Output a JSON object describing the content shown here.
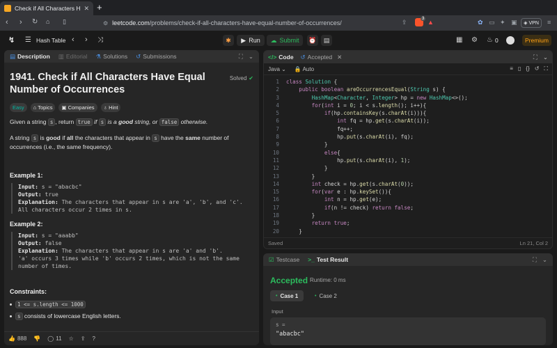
{
  "browser": {
    "tab_title": "Check if All Characters Have",
    "url_host": "leetcode.com",
    "url_path": "/problems/check-if-all-characters-have-equal-number-of-occurrences/",
    "shield_count": "3",
    "vpn_label": "VPN"
  },
  "header": {
    "problem_list": "Hash Table",
    "run_label": "Run",
    "submit_label": "Submit",
    "streak_count": "0",
    "premium_label": "Premium"
  },
  "left": {
    "tabs": {
      "description": "Description",
      "editorial": "Editorial",
      "solutions": "Solutions",
      "submissions": "Submissions"
    },
    "title": "1941. Check if All Characters Have Equal Number of Occurrences",
    "solved": "Solved",
    "chips": {
      "difficulty": "Easy",
      "topics": "Topics",
      "companies": "Companies",
      "hint": "Hint"
    },
    "p1": {
      "a": "Given a string ",
      "s": "s",
      "b": ", return ",
      "true": "true",
      "c": " if ",
      "s2": "s",
      "d": " is a ",
      "good": "good",
      "e": " string, or ",
      "false": "false",
      "f": " otherwise."
    },
    "p2": {
      "a": "A string ",
      "s": "s",
      "b": " is ",
      "good": "good",
      "c": " if ",
      "all": "all",
      "d": " the characters that appear in ",
      "s2": "s",
      "e": " have the ",
      "same": "same",
      "f": " number of occurrences (i.e., the same frequency)."
    },
    "example1": {
      "heading": "Example 1:",
      "input_label": "Input:",
      "input": " s = \"abacbc\"",
      "output_label": "Output:",
      "output": " true",
      "expl_label": "Explanation:",
      "expl": " The characters that appear in s are 'a', 'b', and 'c'. All characters occur 2 times in s."
    },
    "example2": {
      "heading": "Example 2:",
      "input_label": "Input:",
      "input": " s = \"aaabb\"",
      "output_label": "Output:",
      "output": " false",
      "expl_label": "Explanation:",
      "expl": " The characters that appear in s are 'a' and 'b'.",
      "expl2": "'a' occurs 3 times while 'b' occurs 2 times, which is not the same number of times."
    },
    "constraints": {
      "heading": "Constraints:",
      "c1": "1 <= s.length <= 1000",
      "c2_code": "s",
      "c2_text": " consists of lowercase English letters."
    },
    "footer": {
      "likes": "888",
      "comments": "11"
    }
  },
  "code": {
    "tab_code": "Code",
    "tab_accepted": "Accepted",
    "language": "Java",
    "mode": "Auto",
    "status": "Saved",
    "cursor": "Ln 21, Col 2",
    "lines": [
      "class Solution {",
      "    public boolean areOccurrencesEqual(String s) {",
      "        HashMap<Character, Integer> hp = new HashMap<>();",
      "        for(int i = 0; i < s.length(); i++){",
      "            if(hp.containsKey(s.charAt(i))){",
      "                int fq = hp.get(s.charAt(i));",
      "                fq++;",
      "                hp.put(s.charAt(i), fq);",
      "            }",
      "            else{",
      "                hp.put(s.charAt(i), 1);",
      "            }",
      "        }",
      "        int check = hp.get(s.charAt(0));",
      "        for(var e : hp.keySet()){",
      "            int n = hp.get(e);",
      "            if(n != check) return false;",
      "        }",
      "        return true;",
      "    }"
    ]
  },
  "result": {
    "tab_testcase": "Testcase",
    "tab_result": "Test Result",
    "verdict": "Accepted",
    "runtime": "Runtime: 0 ms",
    "case1": "Case 1",
    "case2": "Case 2",
    "input_label": "Input",
    "var_label": "s =",
    "var_value": "\"abacbc\""
  },
  "colors": {
    "accent_green": "#2cbb5d",
    "brand_orange": "#ffa116",
    "easy_teal": "#00b8a3"
  }
}
